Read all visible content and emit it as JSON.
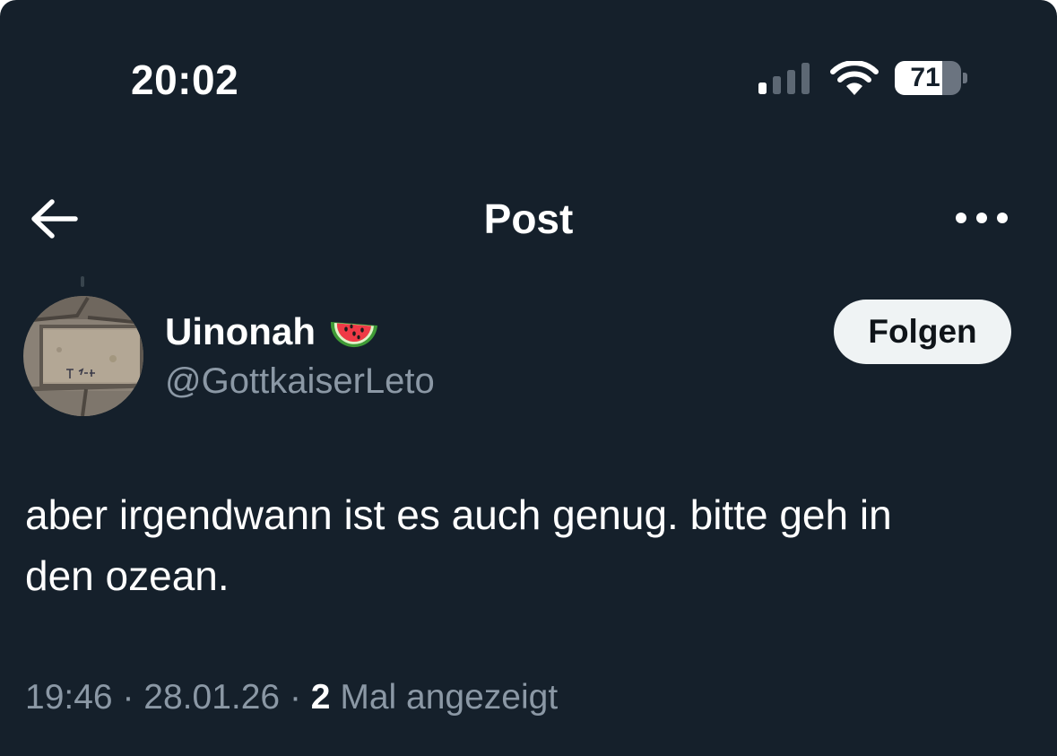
{
  "status_bar": {
    "time": "20:02",
    "battery_level": "71",
    "battery_fraction": 0.71
  },
  "header": {
    "title": "Post",
    "back_icon": "arrow-left-icon",
    "more_icon": "more-horizontal-icon"
  },
  "post": {
    "author": {
      "display_name": "Uinonah",
      "name_emoji": "watermelon-icon",
      "handle": "@GottkaiserLeto"
    },
    "follow_label": "Folgen",
    "text_line_1": "aber irgendwann ist es auch genug. bitte geh in",
    "text_line_2": "den ozean.",
    "meta": {
      "time": "19:46",
      "separator": "·",
      "date": "28.01.26",
      "views_count": "2",
      "views_label": "Mal angezeigt"
    }
  },
  "colors": {
    "background": "#15202b",
    "text_primary": "#ffffff",
    "text_secondary": "#8b98a5",
    "follow_button_bg": "#eff3f4",
    "follow_button_text": "#0f1419"
  }
}
